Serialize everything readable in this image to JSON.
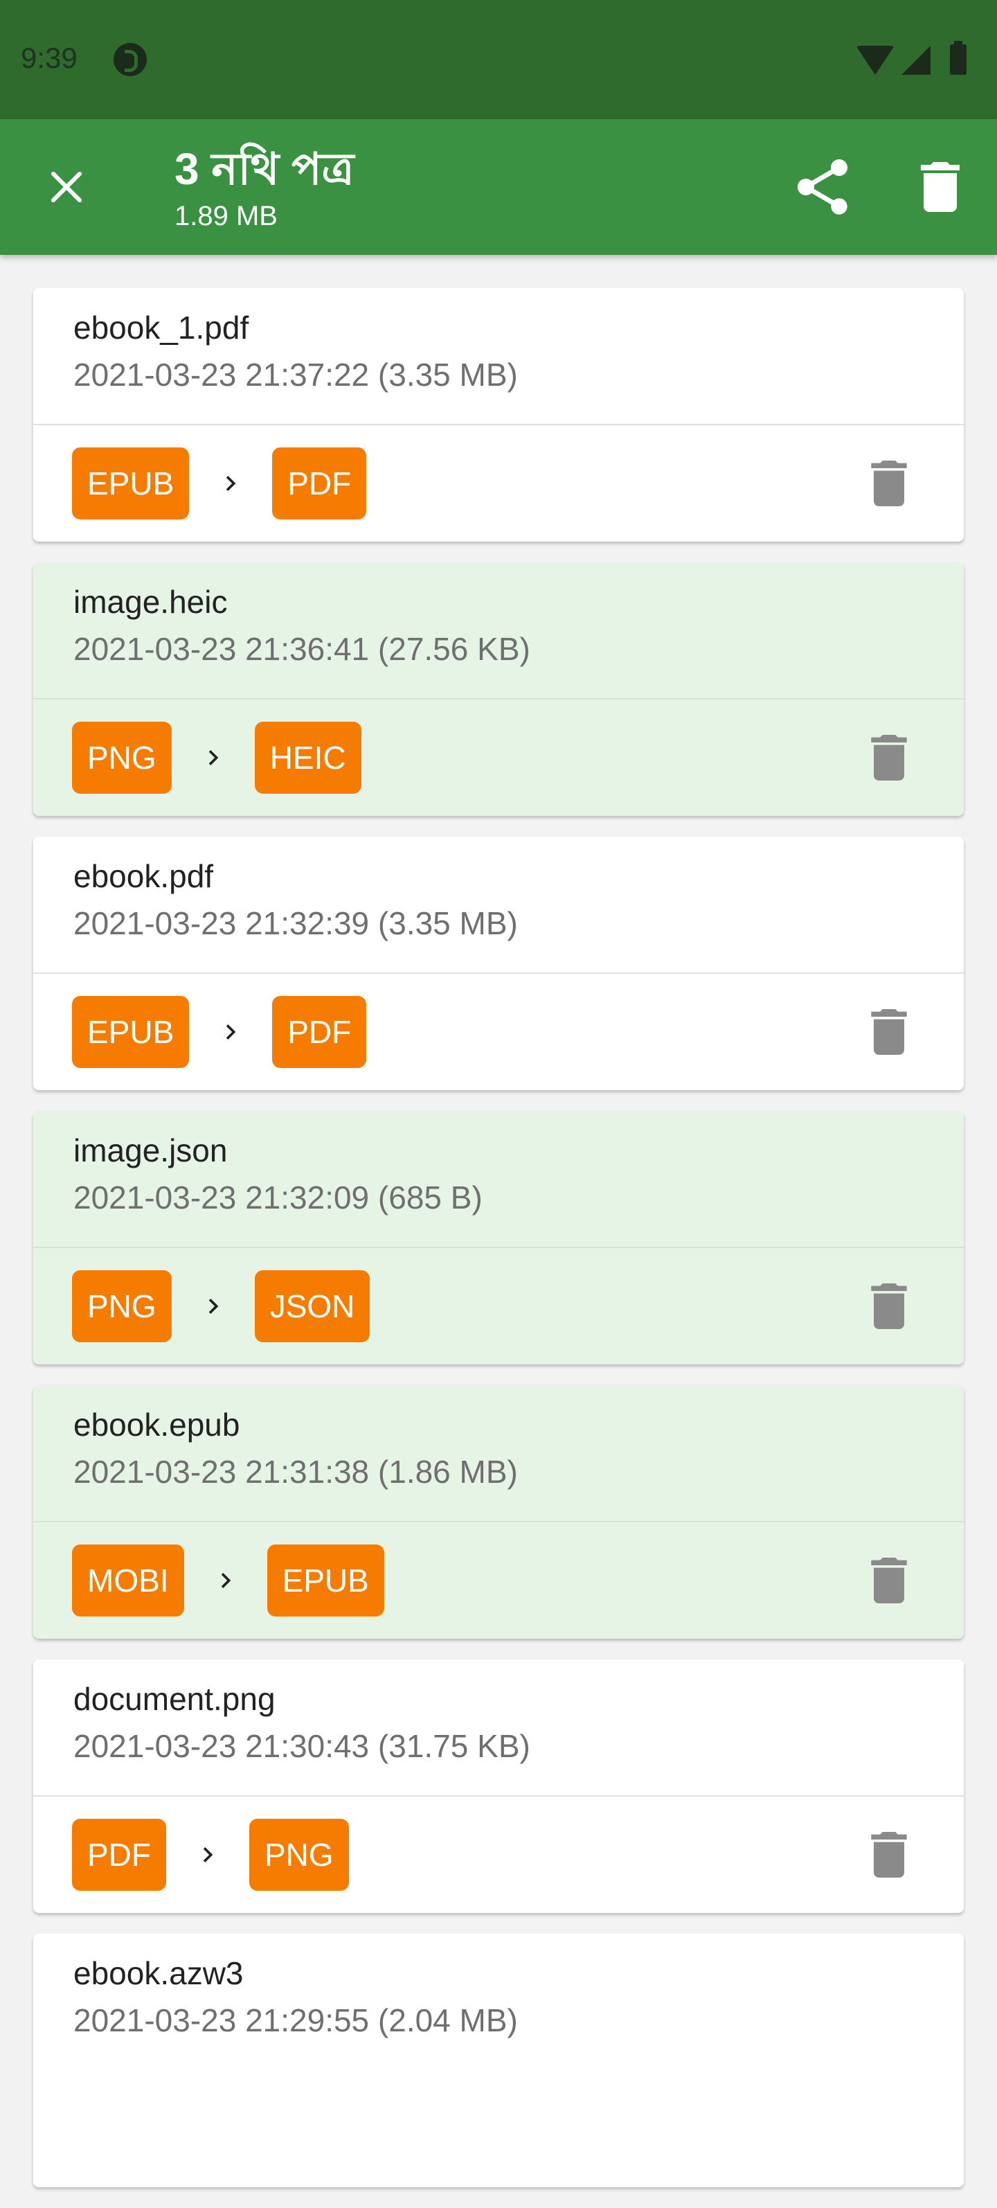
{
  "status_bar": {
    "time": "9:39",
    "icons": [
      "app-notification-icon",
      "wifi-icon",
      "signal-icon",
      "battery-icon"
    ]
  },
  "app_bar": {
    "title": "3 নথি পত্র",
    "subtitle": "1.89 MB",
    "icons": [
      "close-icon",
      "share-icon",
      "delete-icon"
    ],
    "color": "#3a9141"
  },
  "accent_color": "#f57c00",
  "items": [
    {
      "name": "ebook_1.pdf",
      "meta": "2021-03-23 21:37:22 (3.35 MB)",
      "from": "EPUB",
      "to": "PDF",
      "selected": false
    },
    {
      "name": "image.heic",
      "meta": "2021-03-23 21:36:41 (27.56 KB)",
      "from": "PNG",
      "to": "HEIC",
      "selected": true
    },
    {
      "name": "ebook.pdf",
      "meta": "2021-03-23 21:32:39 (3.35 MB)",
      "from": "EPUB",
      "to": "PDF",
      "selected": false
    },
    {
      "name": "image.json",
      "meta": "2021-03-23 21:32:09 (685 B)",
      "from": "PNG",
      "to": "JSON",
      "selected": true
    },
    {
      "name": "ebook.epub",
      "meta": "2021-03-23 21:31:38 (1.86 MB)",
      "from": "MOBI",
      "to": "EPUB",
      "selected": true
    },
    {
      "name": "document.png",
      "meta": "2021-03-23 21:30:43 (31.75 KB)",
      "from": "PDF",
      "to": "PNG",
      "selected": false
    },
    {
      "name": "ebook.azw3",
      "meta": "2021-03-23 21:29:55 (2.04 MB)",
      "from": "",
      "to": "",
      "selected": false
    }
  ]
}
